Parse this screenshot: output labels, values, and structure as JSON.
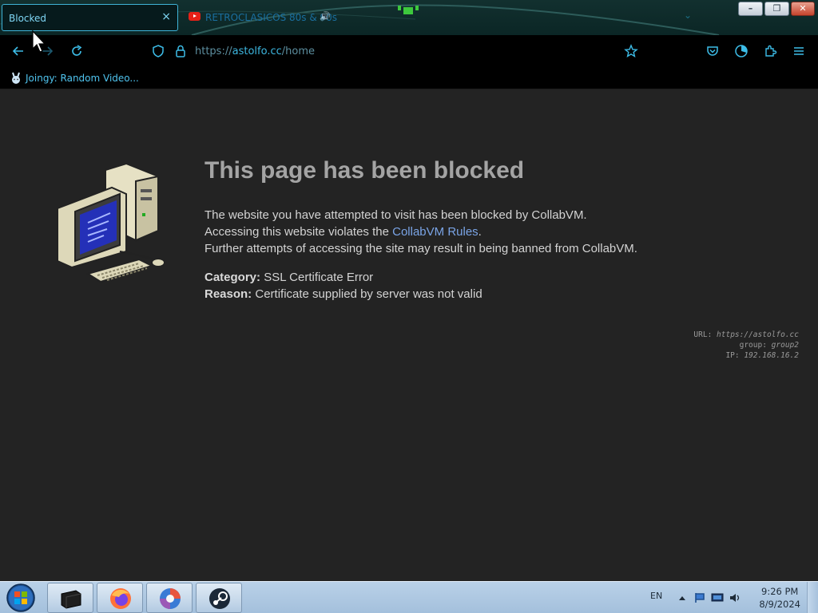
{
  "browser": {
    "tabs": [
      {
        "label": "Blocked",
        "close": "×",
        "active": true
      },
      {
        "label": "RETROCLASICOS 80s & 90s",
        "active": false
      }
    ],
    "tab_list_glyph": "⌄",
    "window_buttons": {
      "minimize": "–",
      "restore": "❐",
      "close": "✕"
    },
    "url": {
      "scheme": "https://",
      "host": "astolfo.cc",
      "path": "/home"
    },
    "bookmarks": [
      {
        "label": "Joingy: Random Video..."
      }
    ]
  },
  "page": {
    "heading": "This page has been blocked",
    "paragraph": {
      "line1": "The website you have attempted to visit has been blocked by CollabVM.",
      "line2_prefix": "Accessing this website violates the ",
      "line2_link": "CollabVM Rules",
      "line2_suffix": ".",
      "line3": "Further attempts of accessing the site may result in being banned from CollabVM."
    },
    "category": {
      "label": "Category:",
      "value": "SSL Certificate Error"
    },
    "reason": {
      "label": "Reason:",
      "value": "Certificate supplied by server was not valid"
    },
    "info": {
      "url_label": "URL:",
      "url_value": "https://astolfo.cc",
      "group_label": "group:",
      "group_value": "group2",
      "ip_label": "IP:",
      "ip_value": "192.168.16.2"
    }
  },
  "taskbar": {
    "language": "EN",
    "time": "9:26 PM",
    "date": "8/9/2024"
  },
  "colors": {
    "accent": "#3dbde8",
    "page_background": "#232323",
    "heading": "#a4a4a4",
    "link": "#7aa4e6"
  },
  "icons": [
    "back-icon",
    "forward-icon",
    "reload-icon",
    "shield-icon",
    "lock-icon",
    "star-icon",
    "pocket-icon",
    "profile-icon",
    "extensions-icon",
    "menu-icon"
  ]
}
